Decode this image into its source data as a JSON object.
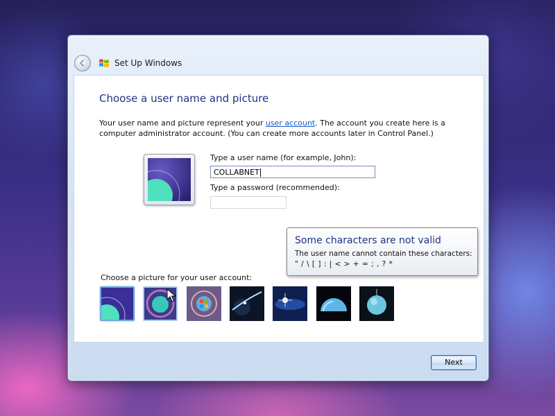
{
  "window": {
    "title": "Set Up Windows",
    "back_button": "back-arrow-icon"
  },
  "page": {
    "heading": "Choose a user name and picture",
    "desc_before_link": "Your user name and picture represent your ",
    "desc_link": "user account",
    "desc_after_link": ". The account you create here is a computer administrator account. (You can create more accounts later in Control Panel.)"
  },
  "form": {
    "username_label": "Type a user name (for example, John):",
    "username_value": "COLLABNET",
    "password_label": "Type a password (recommended):",
    "password_value": ""
  },
  "tooltip": {
    "title": "Some characters are not valid",
    "line1": "The user name cannot contain these characters:",
    "line2": "\" / \\ [ ] : | < > + = ; , ? *"
  },
  "pictures": {
    "label": "Choose a picture for your user account:",
    "items": [
      "aurora-planet",
      "teal-planet-swirl",
      "windows-logo-orb",
      "planet-ring",
      "starburst-nebula",
      "blue-dome",
      "blue-orb"
    ],
    "selected_index": 0,
    "hovered_index": 1
  },
  "buttons": {
    "next": "Next"
  },
  "colors": {
    "heading": "#1e3287",
    "link": "#1558c2",
    "selection_border": "#6fa8e0"
  }
}
